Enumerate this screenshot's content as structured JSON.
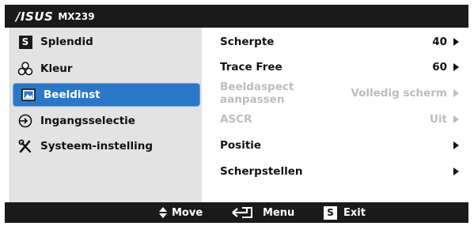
{
  "header": {
    "brand": "/ISUS",
    "model": "MX239"
  },
  "sidebar": {
    "items": [
      {
        "label": "Splendid",
        "icon": "s-box-icon"
      },
      {
        "label": "Kleur",
        "icon": "color-palette-icon"
      },
      {
        "label": "Beeldinst",
        "icon": "image-settings-icon",
        "active": true
      },
      {
        "label": "Ingangsselectie",
        "icon": "input-select-icon"
      },
      {
        "label": "Systeem-instelling",
        "icon": "wrench-screwdriver-icon"
      }
    ],
    "splendid_glyph": "S"
  },
  "settings": {
    "rows": [
      {
        "label": "Scherpte",
        "value": "40",
        "enabled": true
      },
      {
        "label": "Trace Free",
        "value": "60",
        "enabled": true
      },
      {
        "label": "Beeldaspect aanpassen",
        "value": "Volledig scherm",
        "enabled": false
      },
      {
        "label": "ASCR",
        "value": "Uit",
        "enabled": false
      },
      {
        "label": "Positie",
        "value": "",
        "enabled": true
      },
      {
        "label": "Scherpstellen",
        "value": "",
        "enabled": true
      }
    ]
  },
  "footer": {
    "move_label": "Move",
    "menu_label": "Menu",
    "exit_label": "Exit",
    "exit_glyph": "S"
  },
  "colors": {
    "header": "#1a1a1a",
    "active": "#2b78c8",
    "sidebar": "#e3e3e3",
    "disabled": "#bdbdbd"
  }
}
